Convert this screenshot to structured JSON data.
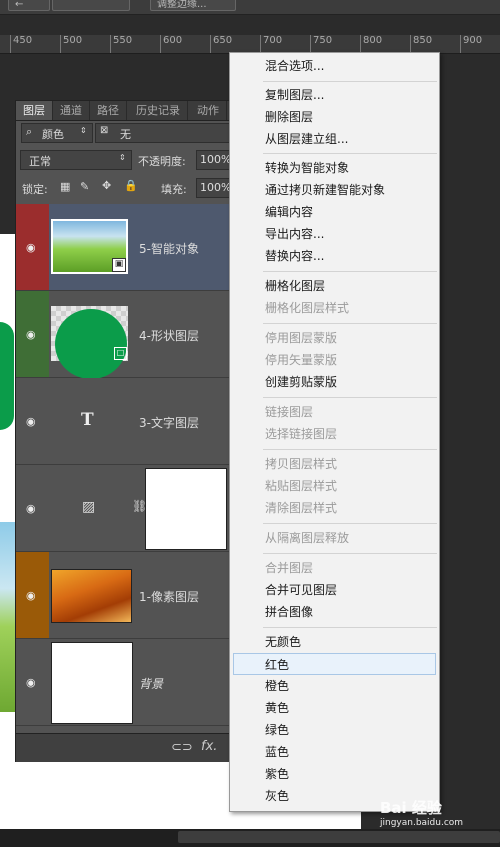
{
  "topbar": {
    "left_btn": "",
    "btn1": "",
    "btn2": "调整边缘..."
  },
  "ruler": {
    "ticks": [
      "450",
      "500",
      "550",
      "600",
      "650",
      "700",
      "750",
      "800",
      "850",
      "900"
    ]
  },
  "panel": {
    "tabs": [
      "图层",
      "通道",
      "路径",
      "历史记录",
      "动作"
    ],
    "filter": {
      "label": "颜色",
      "value": "无"
    },
    "blend_mode": "正常",
    "opacity_label": "不透明度:",
    "opacity_value": "100%",
    "lock_label": "锁定:",
    "fill_label": "填充:",
    "fill_value": "100%",
    "layers": [
      {
        "name": "5-智能对象",
        "color": "#9b2d2d",
        "selected": true
      },
      {
        "name": "4-形状图层",
        "color": "#3f6e36",
        "selected": false
      },
      {
        "name": "3-文字图层",
        "color": "",
        "selected": false
      },
      {
        "name": "",
        "color": "",
        "selected": false
      },
      {
        "name": "1-像素图层",
        "color": "#9a5a08",
        "selected": false
      },
      {
        "name": "背景",
        "color": "",
        "selected": false
      }
    ],
    "text_glyph": "T",
    "footer_fx": "fx."
  },
  "menu": {
    "items": [
      "混合选项...",
      "复制图层...",
      "删除图层",
      "从图层建立组...",
      "转换为智能对象",
      "通过拷贝新建智能对象",
      "编辑内容",
      "导出内容...",
      "替换内容...",
      "栅格化图层",
      "栅格化图层样式",
      "停用图层蒙版",
      "停用矢量蒙版",
      "创建剪贴蒙版",
      "链接图层",
      "选择链接图层",
      "拷贝图层样式",
      "粘贴图层样式",
      "清除图层样式",
      "从隔离图层释放",
      "合并图层",
      "合并可见图层",
      "拼合图像",
      "无颜色",
      "红色",
      "橙色",
      "黄色",
      "绿色",
      "蓝色",
      "紫色",
      "灰色"
    ],
    "disabled": [
      10,
      11,
      12,
      14,
      15,
      16,
      17,
      18,
      19,
      20
    ],
    "hover_index": 24
  },
  "watermark": {
    "main": "Bai 经验",
    "sub": "jingyan.baidu.com"
  }
}
